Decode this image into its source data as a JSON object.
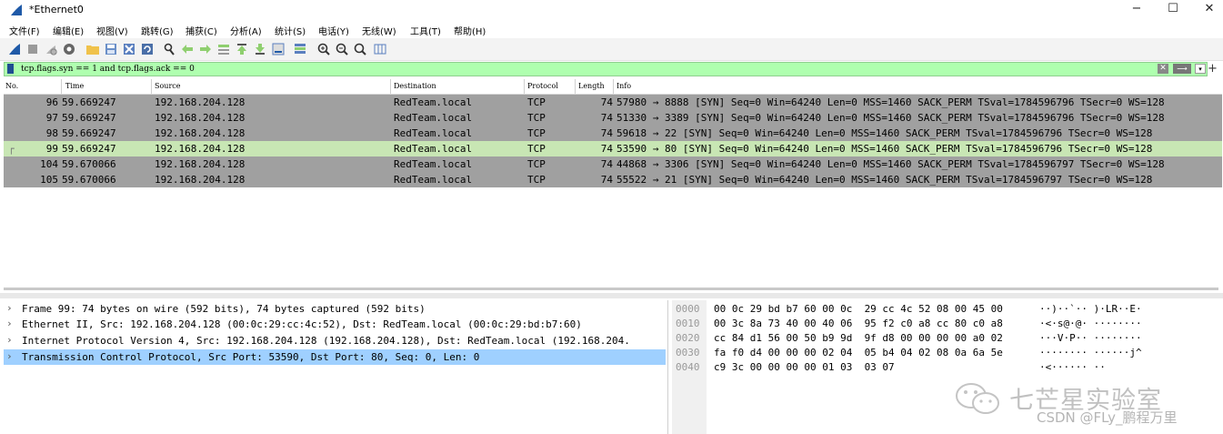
{
  "window": {
    "title": "*Ethernet0",
    "minimize_glyph": "−",
    "maximize_glyph": "☐",
    "close_glyph": "✕"
  },
  "menu": [
    "文件(F)",
    "编辑(E)",
    "视图(V)",
    "跳转(G)",
    "捕获(C)",
    "分析(A)",
    "统计(S)",
    "电话(Y)",
    "无线(W)",
    "工具(T)",
    "帮助(H)"
  ],
  "toolbar_icons": [
    "start-capture-icon",
    "stop-capture-icon",
    "restart-capture-icon",
    "capture-options-icon",
    "open-file-icon",
    "save-file-icon",
    "close-file-icon",
    "reload-icon",
    "find-icon",
    "back-icon",
    "forward-icon",
    "go-to-packet-icon",
    "first-packet-icon",
    "last-packet-icon",
    "autoscroll-icon",
    "colorize-icon",
    "zoom-in-icon",
    "zoom-out-icon",
    "normal-size-icon",
    "resize-columns-icon"
  ],
  "filter": {
    "value": "tcp.flags.syn == 1 and tcp.flags.ack == 0",
    "add_glyph": "+"
  },
  "columns": [
    "No.",
    "Time",
    "Source",
    "Destination",
    "Protocol",
    "Length",
    "Info"
  ],
  "packets": [
    {
      "no": "96",
      "time": "59.669247",
      "src": "192.168.204.128",
      "dst": "RedTeam.local",
      "proto": "TCP",
      "len": "74",
      "info": "57980 → 8888 [SYN] Seq=0 Win=64240 Len=0 MSS=1460 SACK_PERM TSval=1784596796 TSecr=0 WS=128"
    },
    {
      "no": "97",
      "time": "59.669247",
      "src": "192.168.204.128",
      "dst": "RedTeam.local",
      "proto": "TCP",
      "len": "74",
      "info": "51330 → 3389 [SYN] Seq=0 Win=64240 Len=0 MSS=1460 SACK_PERM TSval=1784596796 TSecr=0 WS=128"
    },
    {
      "no": "98",
      "time": "59.669247",
      "src": "192.168.204.128",
      "dst": "RedTeam.local",
      "proto": "TCP",
      "len": "74",
      "info": "59618 → 22 [SYN] Seq=0 Win=64240 Len=0 MSS=1460 SACK_PERM TSval=1784596796 TSecr=0 WS=128"
    },
    {
      "no": "99",
      "time": "59.669247",
      "src": "192.168.204.128",
      "dst": "RedTeam.local",
      "proto": "TCP",
      "len": "74",
      "info": "53590 → 80 [SYN] Seq=0 Win=64240 Len=0 MSS=1460 SACK_PERM TSval=1784596796 TSecr=0 WS=128"
    },
    {
      "no": "104",
      "time": "59.670066",
      "src": "192.168.204.128",
      "dst": "RedTeam.local",
      "proto": "TCP",
      "len": "74",
      "info": "44868 → 3306 [SYN] Seq=0 Win=64240 Len=0 MSS=1460 SACK_PERM TSval=1784596797 TSecr=0 WS=128"
    },
    {
      "no": "105",
      "time": "59.670066",
      "src": "192.168.204.128",
      "dst": "RedTeam.local",
      "proto": "TCP",
      "len": "74",
      "info": "55522 → 21 [SYN] Seq=0 Win=64240 Len=0 MSS=1460 SACK_PERM TSval=1784596797 TSecr=0 WS=128"
    }
  ],
  "selected_packet_no": "99",
  "details": [
    "Frame 99: 74 bytes on wire (592 bits), 74 bytes captured (592 bits)",
    "Ethernet II, Src: 192.168.204.128 (00:0c:29:cc:4c:52), Dst: RedTeam.local (00:0c:29:bd:b7:60)",
    "Internet Protocol Version 4, Src: 192.168.204.128 (192.168.204.128), Dst: RedTeam.local (192.168.204.",
    "Transmission Control Protocol, Src Port: 53590, Dst Port: 80, Seq: 0, Len: 0"
  ],
  "bytes": [
    {
      "off": "0000",
      "hex": "00 0c 29 bd b7 60 00 0c  29 cc 4c 52 08 00 45 00",
      "ascii": "··)··`·· )·LR··E·"
    },
    {
      "off": "0010",
      "hex": "00 3c 8a 73 40 00 40 06  95 f2 c0 a8 cc 80 c0 a8",
      "ascii": "·<·s@·@· ········"
    },
    {
      "off": "0020",
      "hex": "cc 84 d1 56 00 50 b9 9d  9f d8 00 00 00 00 a0 02",
      "ascii": "···V·P·· ········"
    },
    {
      "off": "0030",
      "hex": "fa f0 d4 00 00 00 02 04  05 b4 04 02 08 0a 6a 5e",
      "ascii": "········ ······j^"
    },
    {
      "off": "0040",
      "hex": "c9 3c 00 00 00 00 01 03  03 07",
      "ascii": "·<······ ··"
    }
  ],
  "watermark": {
    "chinese": "七芒星实验室",
    "csdn": "CSDN @FLy_鹏程万里"
  },
  "colors": {
    "row_default": "#a0a0a0",
    "row_selected": "#c8e6b4",
    "detail_selected": "#9fd0ff",
    "filter_valid": "#afffaf"
  }
}
